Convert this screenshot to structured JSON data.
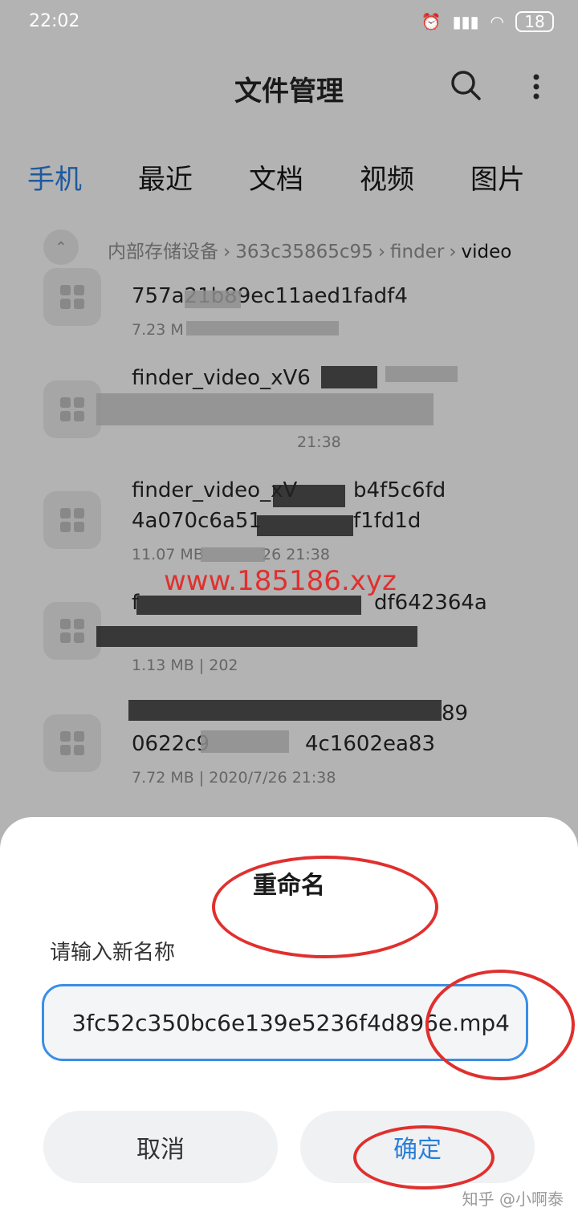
{
  "status": {
    "time": "22:02",
    "battery": "18"
  },
  "header": {
    "title": "文件管理"
  },
  "tabs": [
    "手机",
    "最近",
    "文档",
    "视频",
    "图片"
  ],
  "breadcrumb": {
    "root": "内部存储设备",
    "mid": "363c35865c95",
    "folder": "finder",
    "current": "video"
  },
  "files": [
    {
      "name1": "757a21b89ec11aed1fadf4",
      "name2": "",
      "meta": "7.23 M"
    },
    {
      "name1": "finder_video_xV6",
      "name2": "",
      "meta": "21:38"
    },
    {
      "name1": "finder_video_xV",
      "name2": "4a070c6a51",
      "name1b": "b4f5c6fd",
      "name2b": "f1fd1d",
      "meta": "11.07 MB",
      "metab": "26 21:38"
    },
    {
      "name1": "f",
      "name1b": "df642364a",
      "name2": "",
      "meta": "1.13 MB | 202"
    },
    {
      "name1": "",
      "name1b": "89",
      "name2": "0622c9",
      "name2b": "4c1602ea83",
      "meta": "7.72 MB | 2020/7/26 21:38"
    }
  ],
  "watermark": "www.185186.xyz",
  "dialog": {
    "title": "重命名",
    "prompt": "请输入新名称",
    "input_value": "3fc52c350bc6e139e5236f4d896e.mp4",
    "cancel_label": "取消",
    "confirm_label": "确定"
  },
  "credit": "知乎 @小啊泰",
  "colors": {
    "accent": "#2a7fd8",
    "annotation": "#e0302e"
  }
}
